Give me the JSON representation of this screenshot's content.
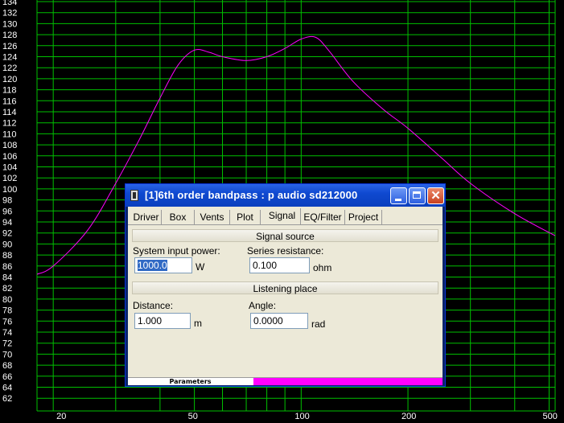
{
  "plot": {
    "y_ticks": [
      "134",
      "132",
      "130",
      "128",
      "126",
      "124",
      "122",
      "120",
      "118",
      "116",
      "114",
      "112",
      "110",
      "108",
      "106",
      "104",
      "102",
      "100",
      "98",
      "96",
      "94",
      "92",
      "90",
      "88",
      "86",
      "84",
      "82",
      "80",
      "78",
      "76",
      "74",
      "72",
      "70",
      "68",
      "66",
      "64",
      "62"
    ],
    "x_ticks": [
      "20",
      "50",
      "100",
      "200",
      "500"
    ],
    "colors": {
      "background": "#000000",
      "grid": "#00c000",
      "curve": "#ff00ff",
      "axis_text": "#ffffff"
    }
  },
  "chart_data": {
    "type": "line",
    "x_scale": "log",
    "xlim": [
      18,
      520
    ],
    "ylim": [
      61,
      134
    ],
    "grid": true,
    "series": [
      {
        "x": [
          18,
          20,
          25,
          30,
          35,
          40,
          45,
          50,
          55,
          60,
          70,
          80,
          90,
          100,
          110,
          120,
          140,
          170,
          200,
          250,
          300,
          400,
          520
        ],
        "y": [
          84.5,
          86.0,
          92.5,
          101.0,
          109.0,
          116.5,
          122.5,
          125.2,
          124.8,
          124.0,
          123.3,
          124.0,
          125.5,
          127.2,
          127.5,
          125.0,
          119.5,
          114.5,
          111.0,
          105.5,
          101.0,
          95.5,
          91.5
        ]
      }
    ]
  },
  "dialog": {
    "title": "[1]6th order bandpass : p audio sd212000",
    "tabs": [
      "Driver",
      "Box",
      "Vents",
      "Plot",
      "Signal",
      "EQ/Filter",
      "Project"
    ],
    "active_tab": "Signal",
    "signal_source": {
      "heading": "Signal source",
      "power_label": "System input power:",
      "power_value": "1000.0",
      "power_unit": "W",
      "resistance_label": "Series resistance:",
      "resistance_value": "0.100",
      "resistance_unit": "ohm"
    },
    "listening_place": {
      "heading": "Listening place",
      "distance_label": "Distance:",
      "distance_value": "1.000",
      "distance_unit": "m",
      "angle_label": "Angle:",
      "angle_value": "0.0000",
      "angle_unit": "rad"
    },
    "status": {
      "label": "Parameters",
      "bar_color": "#ff00ff"
    }
  }
}
